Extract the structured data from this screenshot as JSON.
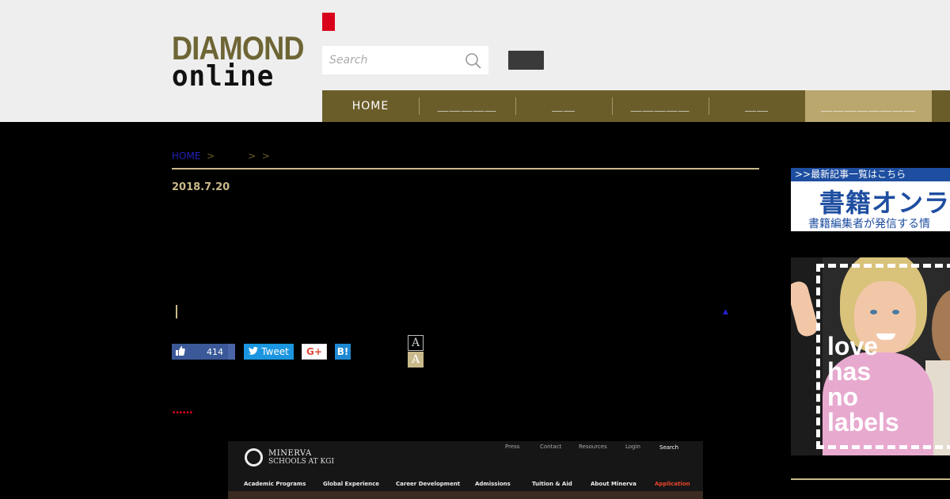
{
  "header": {
    "logo_line1": "DIAMOND",
    "logo_line2": "online",
    "search_placeholder": "Search",
    "accent_color": "#d9001b",
    "nav_color": "#6b5d2a",
    "nav": [
      {
        "label": "HOME"
      },
      {
        "label": "＿＿＿＿＿"
      },
      {
        "label": "＿＿"
      },
      {
        "label": "＿＿＿＿＿"
      },
      {
        "label": "＿＿"
      },
      {
        "label": "＿＿＿＿＿＿＿＿"
      }
    ]
  },
  "article": {
    "breadcrumb_home": "HOME",
    "breadcrumb_sep": ">",
    "date": "2018.7.20",
    "like_count": "414",
    "tweet_label": "Tweet",
    "gplus_label": "G+",
    "hatena_label": "B!",
    "font_small": "A",
    "font_large": "A",
    "dots": "......"
  },
  "embedded_image": {
    "brand_line1": "MINERVA",
    "brand_line2": "SCHOOLS AT KGI",
    "top_links": [
      "Press",
      "Contact",
      "Resources",
      "Login",
      "Search"
    ],
    "menu": [
      "Academic Programs",
      "Global Experience",
      "Career Development",
      "Admissions",
      "Tuition & Aid",
      "About Minerva",
      "Application"
    ]
  },
  "sidebar": {
    "banner_strip": ">>最新記事一覧はこちら",
    "banner_title": "書籍オンラ",
    "banner_sub": "書籍編集者が発信する情",
    "photo_ad_text": [
      "love",
      "has",
      "no",
      "labels"
    ]
  }
}
